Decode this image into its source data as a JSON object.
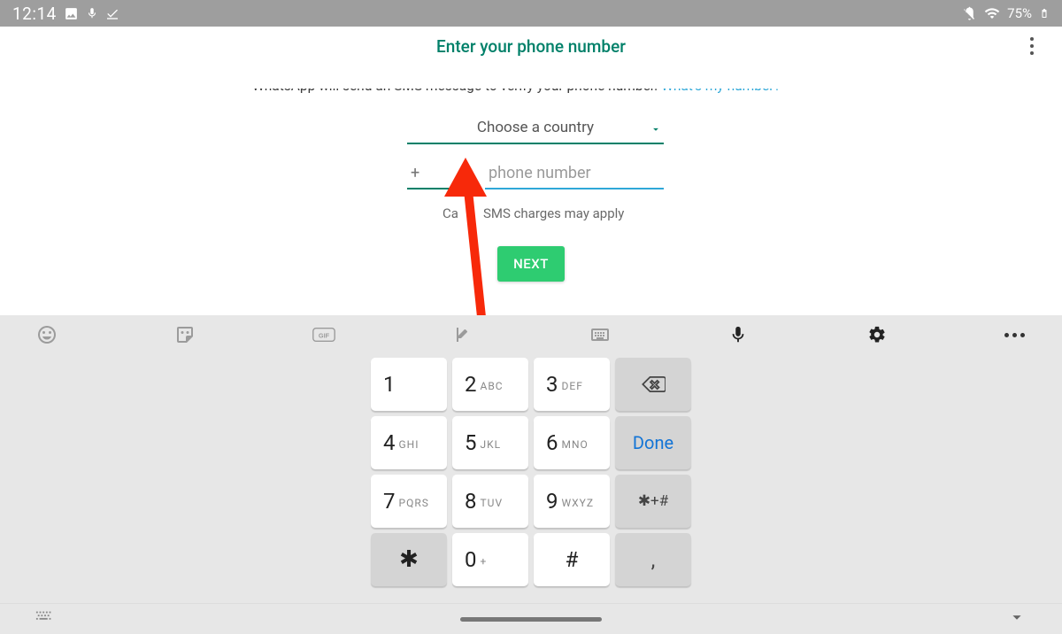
{
  "status": {
    "time": "12:14",
    "battery": "75%"
  },
  "header": {
    "title": "Enter your phone number"
  },
  "body": {
    "message_part1": "WhatsApp will send an SMS message to verify your phone number. ",
    "message_link": "What's my number?",
    "country_label": "Choose a country",
    "code_prefix": "+",
    "phone_placeholder": "phone number",
    "carrier_part1": "Ca",
    "carrier_part2": "SMS charges may apply",
    "next": "NEXT"
  },
  "keyboard": {
    "rows": [
      [
        {
          "d": "1",
          "s": ""
        },
        {
          "d": "2",
          "s": "ABC"
        },
        {
          "d": "3",
          "s": "DEF"
        },
        {
          "special": "backspace"
        }
      ],
      [
        {
          "d": "4",
          "s": "GHI"
        },
        {
          "d": "5",
          "s": "JKL"
        },
        {
          "d": "6",
          "s": "MNO"
        },
        {
          "special": "done",
          "label": "Done"
        }
      ],
      [
        {
          "d": "7",
          "s": "PQRS"
        },
        {
          "d": "8",
          "s": "TUV"
        },
        {
          "d": "9",
          "s": "WXYZ"
        },
        {
          "special": "sym",
          "label": "✱+#"
        }
      ],
      [
        {
          "special": "star",
          "label": "✱"
        },
        {
          "d": "0",
          "s": "+"
        },
        {
          "special": "hash",
          "label": "#"
        },
        {
          "special": "comma",
          "label": ","
        }
      ]
    ]
  }
}
